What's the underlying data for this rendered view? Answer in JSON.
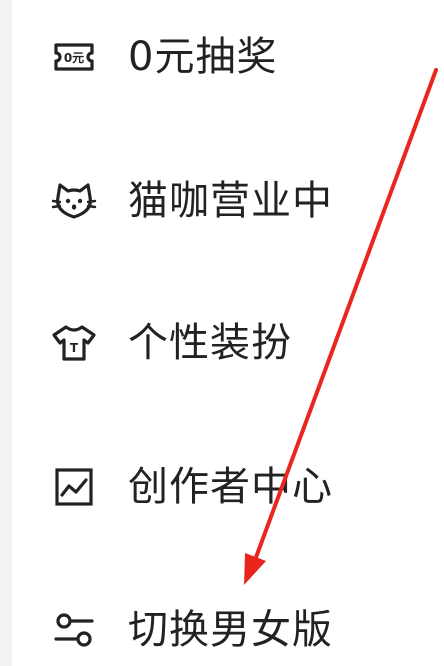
{
  "menu": {
    "items": [
      {
        "label": "0元抽奖",
        "icon": "zero-yuan-ticket-icon",
        "icon_text": "0元"
      },
      {
        "label": "猫咖营业中",
        "icon": "cat-face-icon"
      },
      {
        "label": "个性装扮",
        "icon": "t-shirt-icon",
        "icon_text": "T"
      },
      {
        "label": "创作者中心",
        "icon": "line-chart-icon"
      },
      {
        "label": "切换男女版",
        "icon": "toggle-switch-icon"
      }
    ]
  },
  "colors": {
    "text": "#222222",
    "icon_stroke": "#222222",
    "annotation_arrow": "#e8261e",
    "background": "#ffffff"
  }
}
